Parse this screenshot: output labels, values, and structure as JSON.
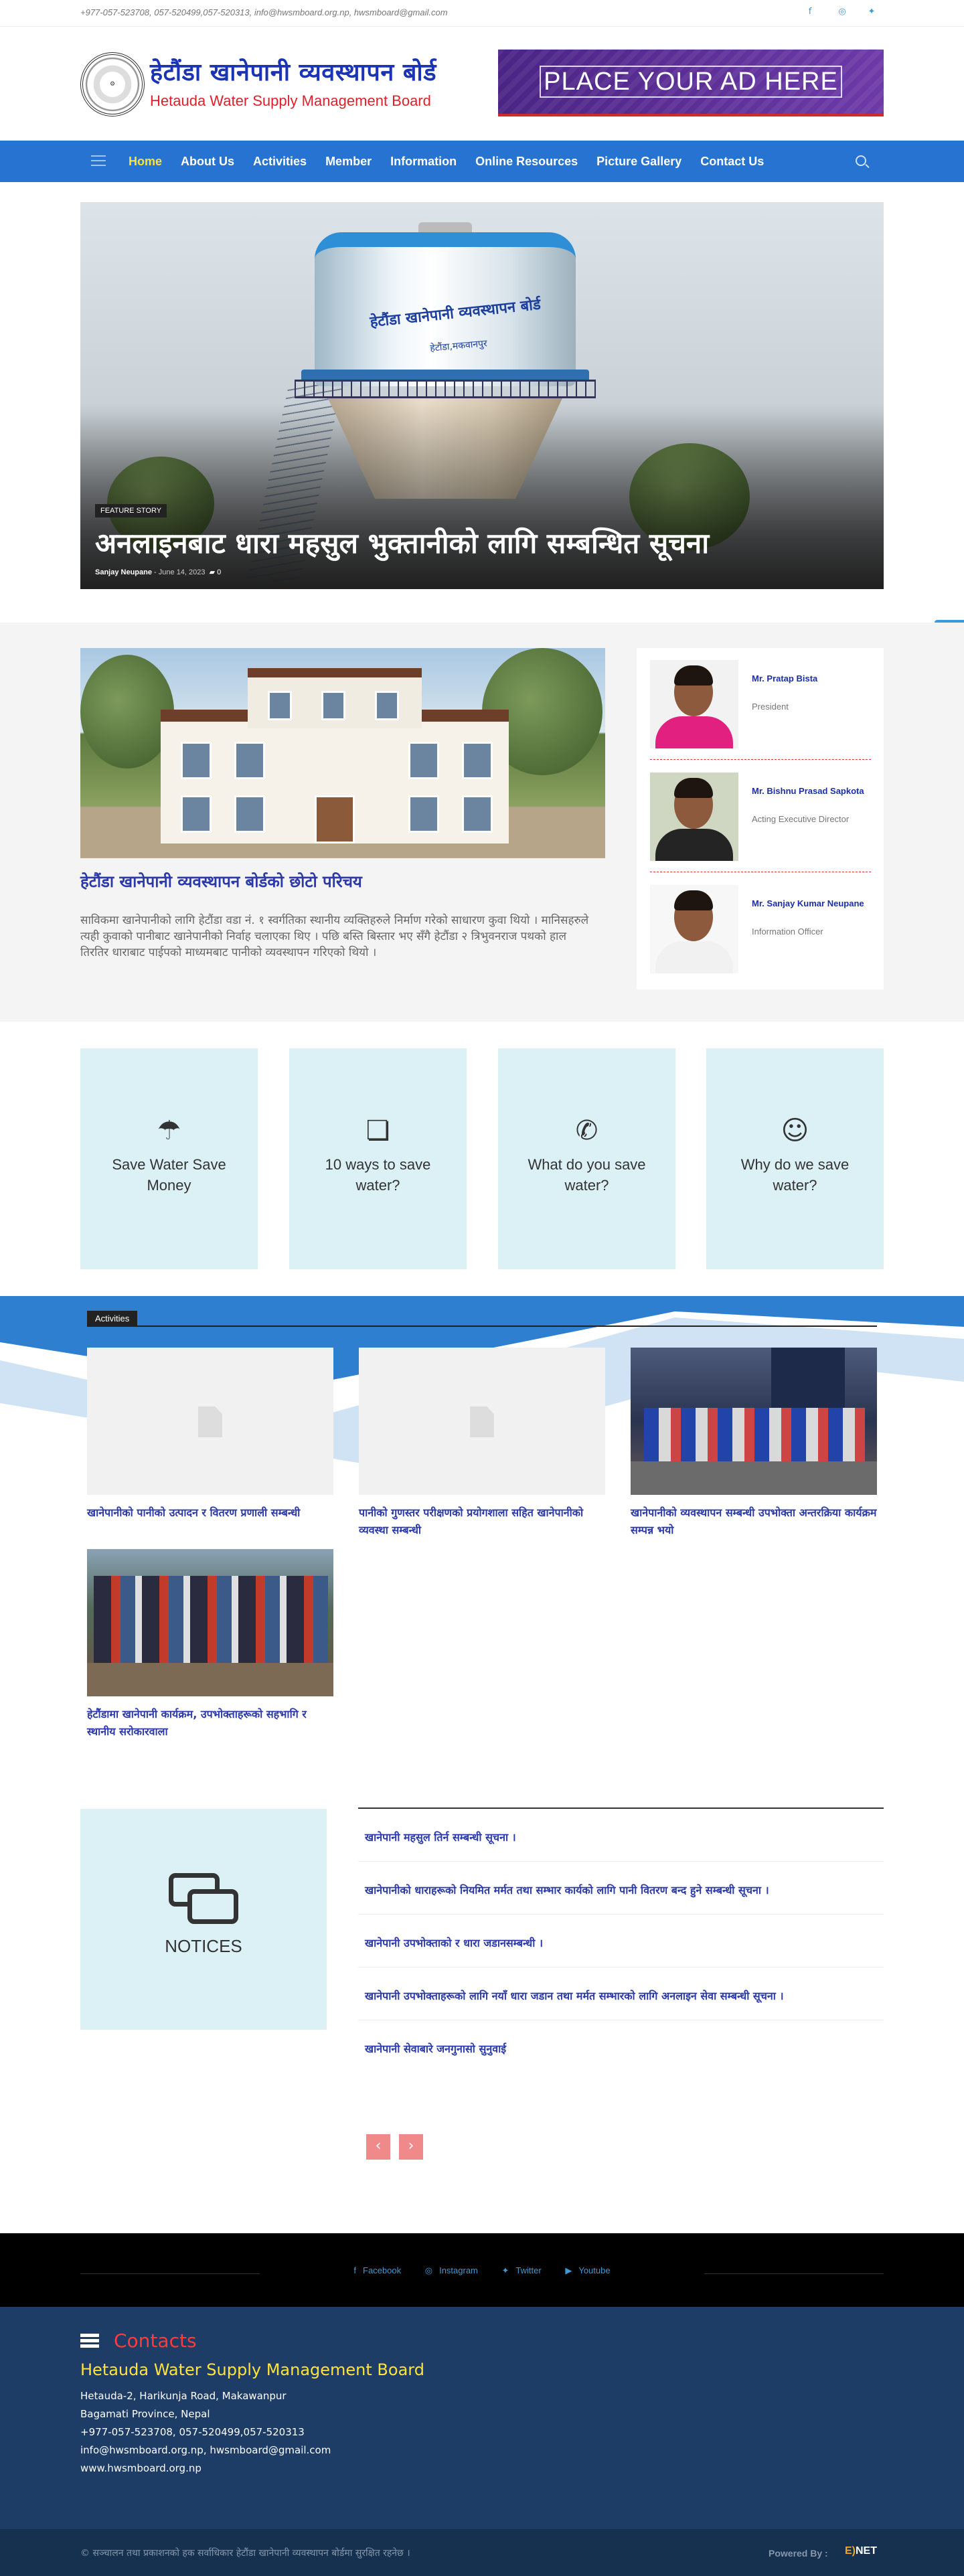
{
  "topbar": {
    "contact": "+977-057-523708, 057-520499,057-520313, info@hwsmboard.org.np, hwsmboard@gmail.com",
    "social": [
      {
        "icon": "facebook-icon",
        "glyph": "f"
      },
      {
        "icon": "instagram-icon",
        "glyph": "◎"
      },
      {
        "icon": "twitter-icon",
        "glyph": "✦"
      }
    ]
  },
  "header": {
    "logo_np": "हेटौंडा खानेपानी व्यवस्थापन बोर्ड",
    "logo_en": "Hetauda Water Supply Management Board",
    "ad_text": "PLACE YOUR AD HERE"
  },
  "nav": {
    "items": [
      "Home",
      "About Us",
      "Activities",
      "Member",
      "Information",
      "Online Resources",
      "Picture Gallery",
      "Contact Us"
    ],
    "active": "Home"
  },
  "hero": {
    "badge": "FEATURE STORY",
    "title": "अनलाइनबाट धारा महसुल भुक्तानीको लागि सम्बन्धित सूचना",
    "author": "Sanjay Neupane",
    "date": "June 14, 2023",
    "comments": "0",
    "tank_title": "हेटौंडा खानेपानी व्यवस्थापन बोर्ड",
    "tank_sub": "हेटौंडा,मकवानपुर"
  },
  "about": {
    "title": "हेटौंडा खानेपानी व्यवस्थापन बोर्डको छोटो परिचय",
    "text": "साविकमा खानेपानीको लागि हेटौंडा वडा नं. १ स्वर्गतिका स्थानीय व्यक्तिहरुले निर्माण गरेको साधारण कुवा थियो । मानिसहरुले त्यही कुवाको पानीबाट खानेपानीको निर्वाह चलाएका थिए । पछि बस्ति बिस्तार भए सँगै हेटौंडा २ त्रिभुवनराज पथको हाल तिरतिर धाराबाट पाईपको माध्यमबाट पानीको व्यवस्थापन गरिएको थियो ।"
  },
  "staff": [
    {
      "name": "Mr. Pratap Bista",
      "role": "President",
      "shirt": "#e2207f",
      "bg": "#f2f2f2"
    },
    {
      "name": "Mr. Bishnu Prasad Sapkota",
      "role": "Acting Executive Director",
      "shirt": "#242424",
      "bg": "#cfd6c2"
    },
    {
      "name": "Mr. Sanjay Kumar Neupane",
      "role": "Information Officer",
      "shirt": "#f1f1f1",
      "bg": "#f7f7f7"
    }
  ],
  "tips": [
    {
      "icon": "rain-cloud-icon",
      "glyph": "☂",
      "title": "Save Water Save Money"
    },
    {
      "icon": "chat-bubbles-icon",
      "glyph": "❏",
      "title": "10 ways to save water?"
    },
    {
      "icon": "whatsapp-icon",
      "glyph": "✆",
      "title": "What do you save water?"
    },
    {
      "icon": "users-icon",
      "glyph": "☺",
      "title": "Why do we save water?"
    }
  ],
  "activities": {
    "heading": "Activities",
    "items": [
      {
        "title": "खानेपानीको पानीको उत्पादन र वितरण प्रणाली सम्बन्धी",
        "image": "placeholder"
      },
      {
        "title": "पानीको गुणस्तर परीक्षणको प्रयोगशाला सहित खानेपानीको व्यवस्था सम्बन्धी",
        "image": "placeholder"
      },
      {
        "title": "खानेपानीको व्यवस्थापन सम्बन्धी उपभोक्ता अन्तरक्रिया कार्यक्रम सम्पन्न भयो",
        "image": "event"
      },
      {
        "title": "हेटौंडामा खानेपानी कार्यक्रम, उपभोक्ताहरूको सहभागि र स्थानीय सरोकारवाला",
        "image": "crowd"
      }
    ]
  },
  "notices": {
    "label": "NOTICES",
    "items": [
      "खानेपानी महसुल तिर्न सम्बन्धी सूचना ।",
      "खानेपानीको धाराहरूको नियमित मर्मत तथा सम्भार कार्यको लागि पानी वितरण बन्द हुने सम्बन्धी सूचना ।",
      "खानेपानी उपभोक्ताको र धारा जडानसम्बन्धी ।",
      "खानेपानी उपभोक्ताहरूको लागि नयाँ धारा जडान तथा मर्मत सम्भारको लागि अनलाइन सेवा सम्बन्धी सूचना ।",
      "खानेपानी सेवाबारे जनगुनासो सुनुवाई"
    ],
    "prev": "‹",
    "next": "›"
  },
  "footer_social": [
    {
      "icon": "facebook-icon",
      "glyph": "f",
      "label": "Facebook"
    },
    {
      "icon": "instagram-icon",
      "glyph": "◎",
      "label": "Instagram"
    },
    {
      "icon": "twitter-icon",
      "glyph": "✦",
      "label": "Twitter"
    },
    {
      "icon": "youtube-icon",
      "glyph": "▶",
      "label": "Youtube"
    }
  ],
  "contacts": {
    "heading": "Contacts",
    "org": "Hetauda Water Supply Management Board",
    "lines": [
      "Hetauda-2, Harikunja Road, Makawanpur",
      "Bagamati Province, Nepal",
      "+977-057-523708, 057-520499,057-520313",
      "info@hwsmboard.org.np, hwsmboard@gmail.com",
      "www.hwsmboard.org.np"
    ]
  },
  "copyright": {
    "text": "© सञ्चालन तथा प्रकाशनको हक सर्वाधिकार हेटौंडा खानेपानी व्यवस्थापन बोर्डमा सुरक्षित रहनेछ ।",
    "powered_by": "Powered By :",
    "brand_a": "E)",
    "brand_b": "NET"
  },
  "colors": {
    "nav": "#2673d1",
    "accent": "#3b9bd8",
    "link": "#2b3aa8",
    "tip_bg": "#dbf1f6",
    "footer": "#1e3d66"
  }
}
